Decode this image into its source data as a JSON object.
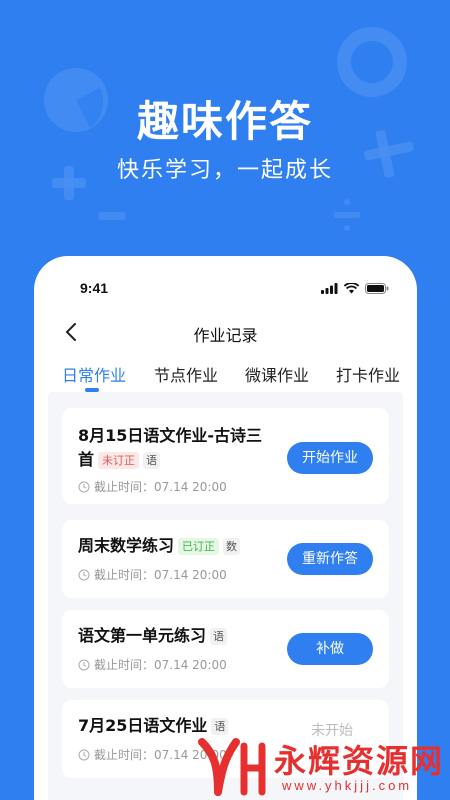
{
  "hero": {
    "title": "趣味作答",
    "subtitle": "快乐学习，一起成长"
  },
  "status_bar": {
    "time": "9:41"
  },
  "nav": {
    "title": "作业记录",
    "back_icon": "chevron-left-icon"
  },
  "tabs": [
    {
      "label": "日常作业",
      "active": true
    },
    {
      "label": "节点作业",
      "active": false
    },
    {
      "label": "微课作业",
      "active": false
    },
    {
      "label": "打卡作业",
      "active": false
    }
  ],
  "cards": [
    {
      "title_line1": "8月15日语文作业-古诗三",
      "title_line2": "首",
      "badge": "未订正",
      "subject": "语",
      "deadline": "截止时间：07.14 20:00",
      "action": "开始作业"
    },
    {
      "title": "周末数学练习",
      "badge": "已订正",
      "subject": "数",
      "deadline": "截止时间：07.14 20:00",
      "action": "重新作答"
    },
    {
      "title": "语文第一单元练习",
      "subject": "语",
      "deadline": "截止时间：07.14 20:00",
      "action": "补做"
    },
    {
      "title": "7月25日语文作业",
      "subject": "语",
      "deadline": "截止时间：07.14 20:00",
      "status": "未开始"
    }
  ],
  "watermark": {
    "text": "永辉资源网",
    "url": "www.yhkjjj.com"
  },
  "colors": {
    "primary": "#2f7ff0",
    "badge_red": "#e25b5b",
    "badge_green": "#3bb54a"
  }
}
